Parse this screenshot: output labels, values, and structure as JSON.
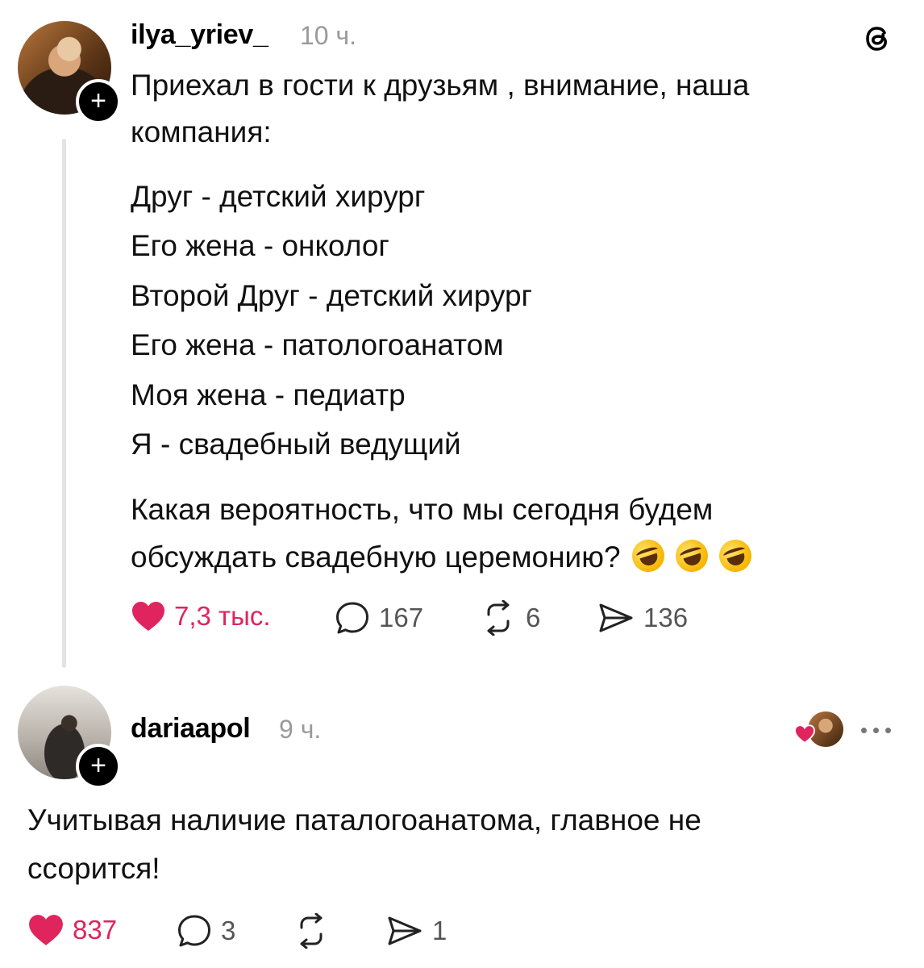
{
  "post": {
    "username": "ilya_yriev_",
    "time": "10 ч.",
    "lines": [
      "Приехал в гости к друзьям , внимание, наша",
      "компания:",
      "",
      "Друг - детский хирург",
      "Его жена - онколог",
      "Второй Друг - детский хирург",
      "Его жена - патологоанатом",
      "Моя жена - педиатр",
      "Я - свадебный ведущий",
      "",
      "Какая вероятность, что мы сегодня будем",
      "обсуждать свадебную церемонию?"
    ],
    "emoji_count": 3,
    "likes": "7,3 тыс.",
    "comments": "167",
    "reposts": "6",
    "shares": "136",
    "liked": true
  },
  "reply": {
    "username": "dariaapol",
    "time": "9 ч.",
    "lines": [
      "Учитывая наличие паталогоанатома, главное не",
      "ссорится!"
    ],
    "likes": "837",
    "comments": "3",
    "reposts": "",
    "shares": "1",
    "liked": true
  },
  "icons": {
    "app": "threads-logo-icon",
    "follow": "plus-icon",
    "like": "heart-icon",
    "comment": "comment-bubble-icon",
    "repost": "repost-icon",
    "share": "send-icon",
    "more": "more-dots-icon"
  },
  "colors": {
    "like": "#e0245e",
    "muted": "#9a9a9a",
    "text": "#111111"
  }
}
